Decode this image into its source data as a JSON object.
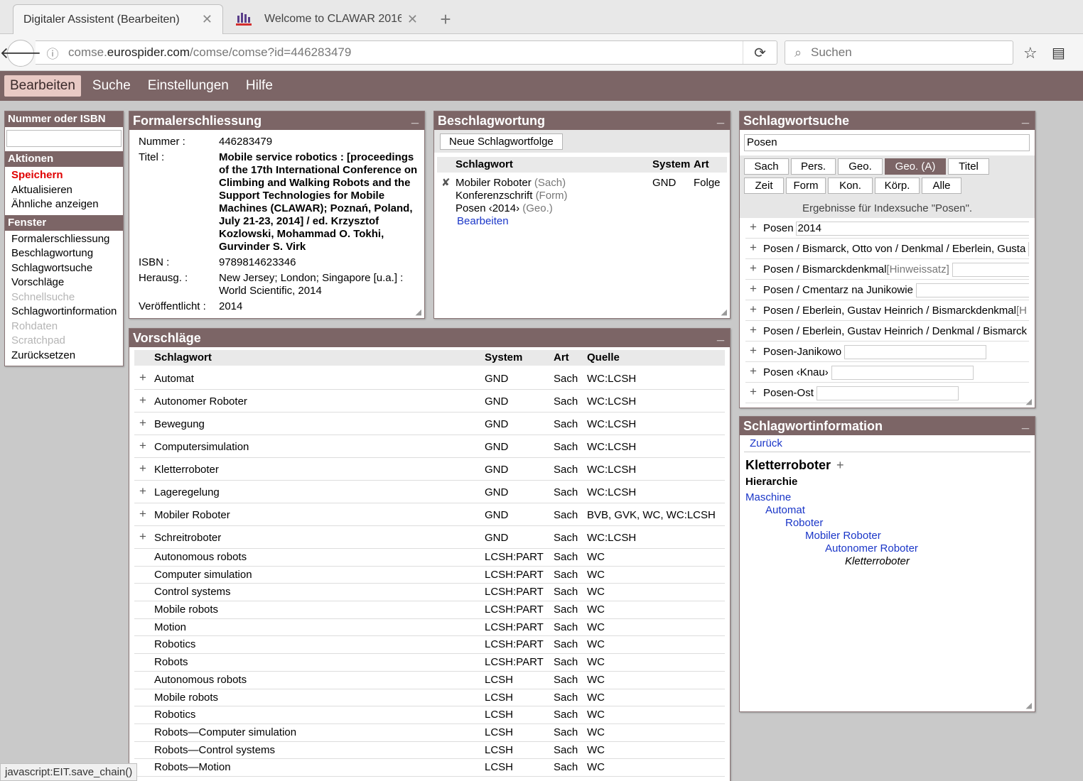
{
  "browser": {
    "tabs": [
      {
        "title": "Digitaler Assistent (Bearbeiten)",
        "active": true
      },
      {
        "title": "Welcome to CLAWAR 2016",
        "active": false
      }
    ],
    "url_prefix": "comse.",
    "url_domain": "eurospider.com",
    "url_path": "/comse/comse?id=446283479",
    "search_placeholder": "Suchen"
  },
  "menu": [
    "Bearbeiten",
    "Suche",
    "Einstellungen",
    "Hilfe"
  ],
  "sidebar": {
    "isbn_header": "Nummer oder ISBN",
    "actions_header": "Aktionen",
    "actions": [
      "Speichern",
      "Aktualisieren",
      "Ähnliche anzeigen"
    ],
    "windows_header": "Fenster",
    "windows": [
      {
        "label": "Formalerschliessung",
        "enabled": true
      },
      {
        "label": "Beschlagwortung",
        "enabled": true
      },
      {
        "label": "Schlagwortsuche",
        "enabled": true
      },
      {
        "label": "Vorschläge",
        "enabled": true
      },
      {
        "label": "Schnellsuche",
        "enabled": false
      },
      {
        "label": "Schlagwortinformation",
        "enabled": true
      },
      {
        "label": "Rohdaten",
        "enabled": false
      },
      {
        "label": "Scratchpad",
        "enabled": false
      },
      {
        "label": "Zurücksetzen",
        "enabled": true
      }
    ]
  },
  "formal": {
    "title": "Formalerschliessung",
    "fields": [
      {
        "label": "Nummer :",
        "value": "446283479",
        "bold": false
      },
      {
        "label": "Titel :",
        "value": "Mobile service robotics : [proceedings of the 17th International Conference on Climbing and Walking Robots and the Support Technologies for Mobile Machines (CLAWAR); Poznań, Poland, July 21-23, 2014] / ed. Krzysztof Kozlowski, Mohammad O. Tokhi, Gurvinder S. Virk",
        "bold": true
      },
      {
        "label": "ISBN :",
        "value": "9789814623346",
        "bold": false
      },
      {
        "label": "Herausg. :",
        "value": "New Jersey; London; Singapore [u.a.] : World Scientific, 2014",
        "bold": false
      },
      {
        "label": "Veröffentlicht :",
        "value": "2014",
        "bold": false
      }
    ]
  },
  "besch": {
    "title": "Beschlagwortung",
    "new_chain_label": "Neue Schlagwortfolge",
    "col_schlagwort": "Schlagwort",
    "col_system": "System",
    "col_art": "Art",
    "chain": {
      "terms": [
        {
          "name": "Mobiler Roboter",
          "type": "(Sach)"
        },
        {
          "name": "Konferenzschrift",
          "type": "(Form)"
        },
        {
          "name": "Posen ‹2014›",
          "type": "(Geo.)"
        }
      ],
      "edit_label": "Bearbeiten",
      "system": "GND",
      "art": "Folge"
    }
  },
  "sws": {
    "title": "Schlagwortsuche",
    "query": "Posen",
    "filters_row1": [
      "Sach",
      "Pers.",
      "Geo.",
      "Geo. (A)",
      "Titel"
    ],
    "filters_row2": [
      "Zeit",
      "Form",
      "Kon.",
      "Körp.",
      "Alle"
    ],
    "selected_filter": "Geo. (A)",
    "result_info": "Ergebnisse für Indexsuche \"Posen\".",
    "results": [
      {
        "label": "Posen",
        "extra": "2014",
        "hint": ""
      },
      {
        "label": "Posen / Bismarck, Otto von / Denkmal / Eberlein, Gusta",
        "extra": "",
        "hint": ""
      },
      {
        "label": "Posen / Bismarckdenkmal",
        "extra": "",
        "hint": "[Hinweissatz]"
      },
      {
        "label": "Posen / Cmentarz na Junikowie",
        "extra": "",
        "hint": ""
      },
      {
        "label": "Posen / Eberlein, Gustav Heinrich / Bismarckdenkmal",
        "extra": "",
        "hint": "[H"
      },
      {
        "label": "Posen / Eberlein, Gustav Heinrich / Denkmal / Bismarck",
        "extra": "",
        "hint": ""
      },
      {
        "label": "Posen-Janikowo",
        "extra": "",
        "hint": ""
      },
      {
        "label": "Posen ‹Knau›",
        "extra": "",
        "hint": ""
      },
      {
        "label": "Posen-Ost",
        "extra": "",
        "hint": ""
      }
    ]
  },
  "swi": {
    "title_panel": "Schlagwortinformation",
    "back_label": "Zurück",
    "term": "Kletterroboter",
    "plus": "+",
    "hierarchy_label": "Hierarchie",
    "hierarchy": [
      "Maschine",
      "Automat",
      "Roboter",
      "Mobiler Roboter",
      "Autonomer Roboter",
      "Kletterroboter"
    ]
  },
  "vors": {
    "title": "Vorschläge",
    "cols": [
      "Schlagwort",
      "System",
      "Art",
      "Quelle"
    ],
    "rows": [
      {
        "term": "Automat",
        "system": "GND",
        "art": "Sach",
        "source": "WC:LCSH",
        "plus": true
      },
      {
        "term": "Autonomer Roboter",
        "system": "GND",
        "art": "Sach",
        "source": "WC:LCSH",
        "plus": true
      },
      {
        "term": "Bewegung",
        "system": "GND",
        "art": "Sach",
        "source": "WC:LCSH",
        "plus": true
      },
      {
        "term": "Computersimulation",
        "system": "GND",
        "art": "Sach",
        "source": "WC:LCSH",
        "plus": true
      },
      {
        "term": "Kletterroboter",
        "system": "GND",
        "art": "Sach",
        "source": "WC:LCSH",
        "plus": true
      },
      {
        "term": "Lageregelung",
        "system": "GND",
        "art": "Sach",
        "source": "WC:LCSH",
        "plus": true
      },
      {
        "term": "Mobiler Roboter",
        "system": "GND",
        "art": "Sach",
        "source": "BVB, GVK, WC, WC:LCSH",
        "plus": true
      },
      {
        "term": "Schreitroboter",
        "system": "GND",
        "art": "Sach",
        "source": "WC:LCSH",
        "plus": true
      },
      {
        "term": "Autonomous robots",
        "system": "LCSH:PART",
        "art": "Sach",
        "source": "WC",
        "plus": false
      },
      {
        "term": "Computer simulation",
        "system": "LCSH:PART",
        "art": "Sach",
        "source": "WC",
        "plus": false
      },
      {
        "term": "Control systems",
        "system": "LCSH:PART",
        "art": "Sach",
        "source": "WC",
        "plus": false
      },
      {
        "term": "Mobile robots",
        "system": "LCSH:PART",
        "art": "Sach",
        "source": "WC",
        "plus": false
      },
      {
        "term": "Motion",
        "system": "LCSH:PART",
        "art": "Sach",
        "source": "WC",
        "plus": false
      },
      {
        "term": "Robotics",
        "system": "LCSH:PART",
        "art": "Sach",
        "source": "WC",
        "plus": false
      },
      {
        "term": "Robots",
        "system": "LCSH:PART",
        "art": "Sach",
        "source": "WC",
        "plus": false
      },
      {
        "term": "Autonomous robots",
        "system": "LCSH",
        "art": "Sach",
        "source": "WC",
        "plus": false
      },
      {
        "term": "Mobile robots",
        "system": "LCSH",
        "art": "Sach",
        "source": "WC",
        "plus": false
      },
      {
        "term": "Robotics",
        "system": "LCSH",
        "art": "Sach",
        "source": "WC",
        "plus": false
      },
      {
        "term": "Robots—Computer simulation",
        "system": "LCSH",
        "art": "Sach",
        "source": "WC",
        "plus": false
      },
      {
        "term": "Robots—Control systems",
        "system": "LCSH",
        "art": "Sach",
        "source": "WC",
        "plus": false
      },
      {
        "term": "Robots—Motion",
        "system": "LCSH",
        "art": "Sach",
        "source": "WC",
        "plus": false
      }
    ]
  },
  "statusbar": "javascript:EIT.save_chain()"
}
